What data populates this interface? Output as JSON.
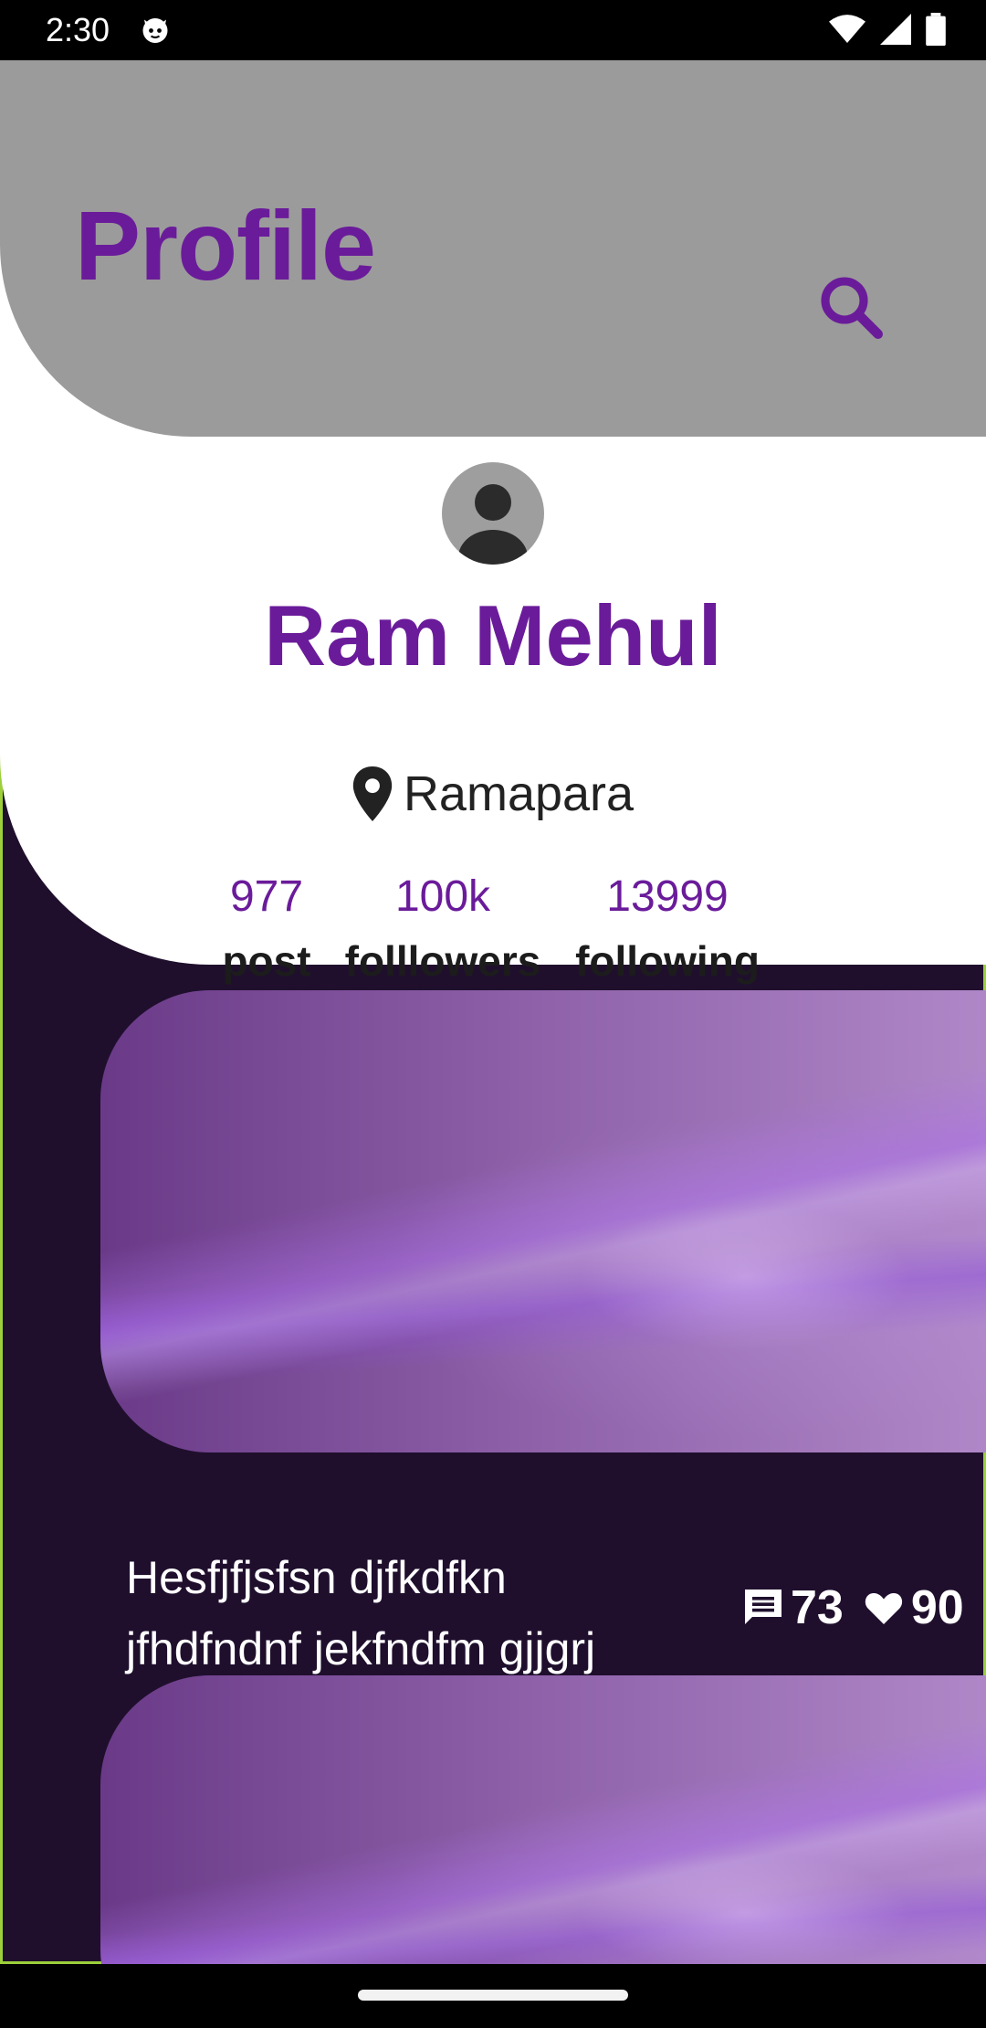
{
  "status_bar": {
    "time": "2:30"
  },
  "header": {
    "title": "Profile"
  },
  "profile": {
    "name": "Ram Mehul",
    "location": "Ramapara",
    "stats": [
      {
        "value": "977",
        "label": "post"
      },
      {
        "value": "100k",
        "label": "folllowers"
      },
      {
        "value": "13999",
        "label": "following"
      }
    ]
  },
  "posts": [
    {
      "caption_line1": "Hesfjfjsfsn djfkdfkn",
      "caption_line2": "jfhdfndnf jekfndfm gjjgrj",
      "comments": "73",
      "likes": "90"
    }
  ],
  "colors": {
    "accent": "#6a1b9a",
    "header_bg": "#9b9b9b",
    "content_bg": "#1f0f2d"
  }
}
